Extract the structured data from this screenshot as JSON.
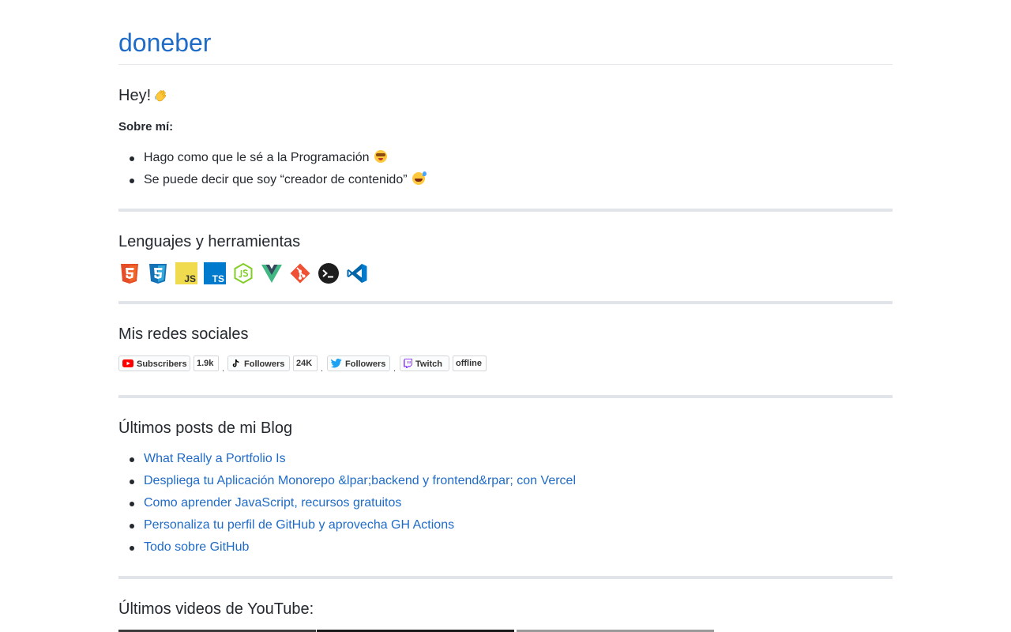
{
  "header": {
    "title": "doneber"
  },
  "intro": {
    "greeting": "Hey!",
    "about_label": "Sobre mí:",
    "items": [
      {
        "text": "Hago como que le sé a la Programación",
        "emoji": "nerd-face-icon"
      },
      {
        "text": "Se puede decir que soy “creador de contenido”",
        "emoji": "grinning-sweat-icon"
      }
    ]
  },
  "tools": {
    "title": "Lenguajes y herramientas",
    "icons": [
      "html5-icon",
      "css3-icon",
      "javascript-icon",
      "typescript-icon",
      "nodejs-icon",
      "vue-icon",
      "git-icon",
      "terminal-icon",
      "vscode-icon"
    ],
    "labels": {
      "js": "JS",
      "ts": "TS"
    }
  },
  "social": {
    "title": "Mis redes sociales",
    "separator": ".",
    "badges": [
      {
        "platform": "youtube",
        "label": "Subscribers",
        "count": "1.9k"
      },
      {
        "platform": "tiktok",
        "label": "Followers",
        "count": "24K"
      },
      {
        "platform": "twitter",
        "label": "Followers"
      },
      {
        "platform": "twitch",
        "label": "Twitch",
        "count": "offline"
      }
    ]
  },
  "blog": {
    "title": "Últimos posts de mi Blog",
    "posts": [
      "What Really a Portfolio Is",
      "Despliega tu Aplicación Monorepo &lpar;backend y frontend&rpar; con Vercel",
      "Como aprender JavaScript, recursos gratuitos",
      "Personaliza tu perfil de GitHub y aprovecha GH Actions",
      "Todo sobre GitHub"
    ]
  },
  "videos": {
    "title": "Últimos videos de YouTube:"
  },
  "colors": {
    "link": "#1f6bc8",
    "text": "#24292f",
    "rule": "#e1e4e8"
  }
}
